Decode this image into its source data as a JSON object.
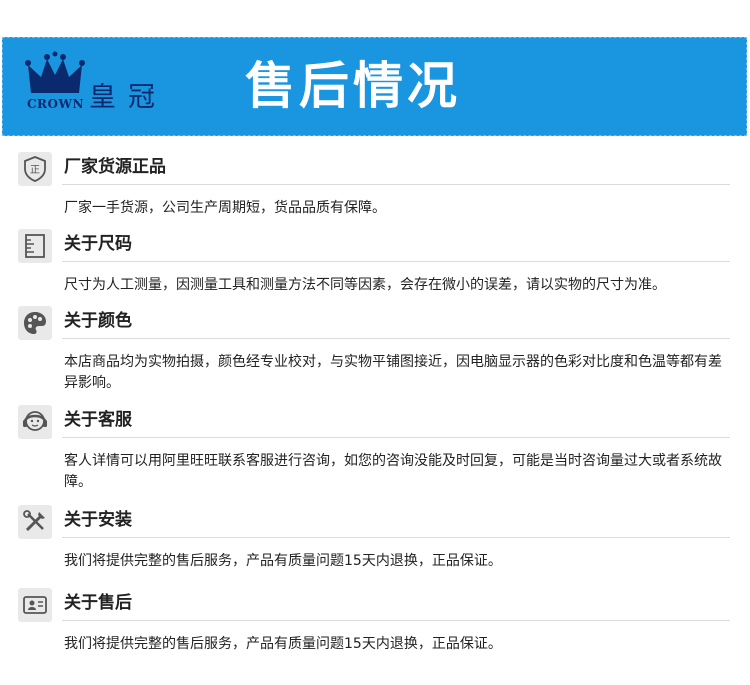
{
  "banner": {
    "logo_text": "CROWN",
    "brand_text": "皇冠",
    "headline": "售后情况",
    "bg_color": "#1a96e0"
  },
  "sections": [
    {
      "icon": "seal-icon",
      "title": "厂家货源正品",
      "text": "厂家一手货源，公司生产周期短，货品品质有保障。"
    },
    {
      "icon": "ruler-icon",
      "title": "关于尺码",
      "text": "尺寸为人工测量，因测量工具和测量方法不同等因素，会存在微小的误差，请以实物的尺寸为准。"
    },
    {
      "icon": "palette-icon",
      "title": "关于颜色",
      "text": "本店商品均为实物拍摄，颜色经专业校对，与实物平铺图接近，因电脑显示器的色彩对比度和色温等都有差异影响。"
    },
    {
      "icon": "headset-icon",
      "title": "关于客服",
      "text": "客人详情可以用阿里旺旺联系客服进行咨询，如您的咨询没能及时回复，可能是当时咨询量过大或者系统故障。"
    },
    {
      "icon": "tools-icon",
      "title": "关于安装",
      "text": "我们将提供完整的售后服务，产品有质量问题15天内退换，正品保证。"
    },
    {
      "icon": "id-card-icon",
      "title": "关于售后",
      "text": "我们将提供完整的售后服务，产品有质量问题15天内退换，正品保证。"
    }
  ]
}
